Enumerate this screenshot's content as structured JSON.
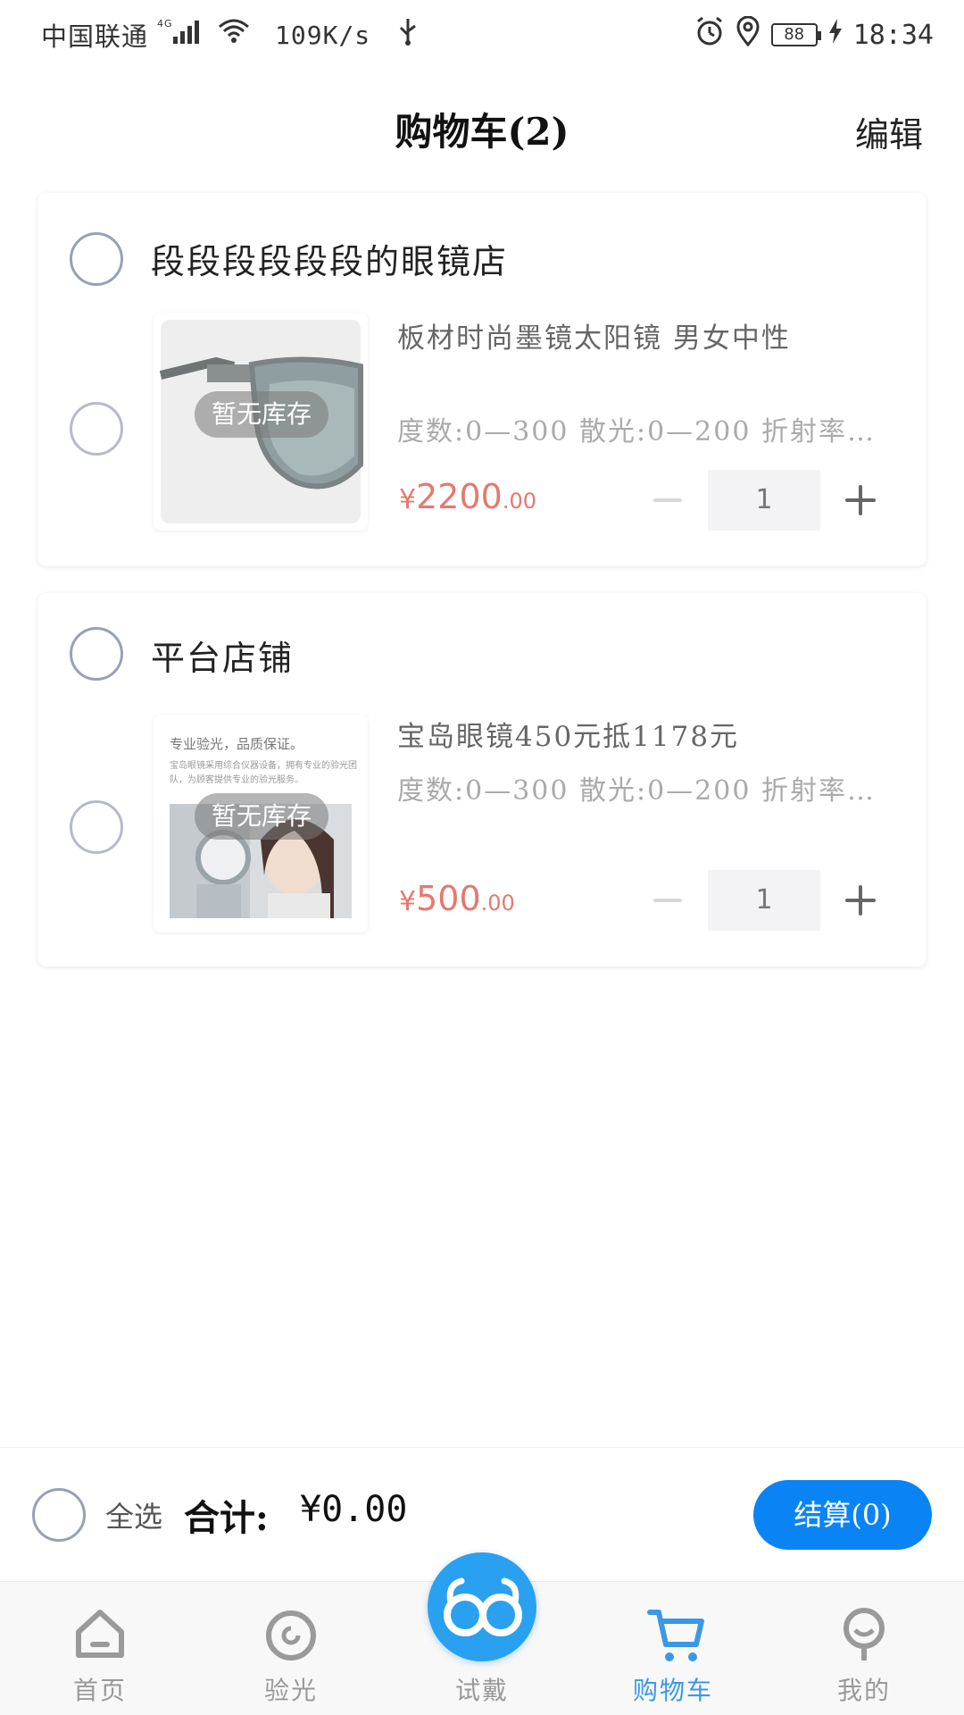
{
  "status_bar": {
    "carrier": "中国联通",
    "network": "4G",
    "speed": "109K/s",
    "battery": "88",
    "time": "18:34"
  },
  "header": {
    "title": "购物车(2)",
    "edit_label": "编辑"
  },
  "shops": [
    {
      "name": "段段段段段段的眼镜店",
      "item": {
        "title": "板材时尚墨镜太阳镜 男女中性",
        "spec": "度数:0—300 散光:0—200 折射率…",
        "stock_label": "暂无库存",
        "price_currency": "¥",
        "price_int": "2200",
        "price_dec": ".00",
        "qty": "1"
      }
    },
    {
      "name": "平台店铺",
      "item": {
        "title": "宝岛眼镜450元抵1178元",
        "spec": "度数:0—300 散光:0—200 折射率…",
        "stock_label": "暂无库存",
        "price_currency": "¥",
        "price_int": "500",
        "price_dec": ".00",
        "qty": "1",
        "image_headline": "专业验光，品质保证。",
        "image_subtext": "宝岛眼镜采用综合仪器设备，拥有专业的验光团队，为顾客提供专业的验光服务。"
      }
    }
  ],
  "checkout": {
    "select_all_label": "全选",
    "total_label": "合计:",
    "total_value": "¥0.00",
    "pay_label": "结算(0)"
  },
  "tabbar": {
    "items": [
      {
        "label": "首页",
        "icon": "home-icon"
      },
      {
        "label": "验光",
        "icon": "target-icon"
      },
      {
        "label": "试戴",
        "icon": "glasses-icon"
      },
      {
        "label": "购物车",
        "icon": "cart-icon"
      },
      {
        "label": "我的",
        "icon": "user-icon"
      }
    ],
    "active_index": 3,
    "active_color": "#3b98e6"
  },
  "colors": {
    "accent": "#0a84f5",
    "price": "#e5796f"
  }
}
